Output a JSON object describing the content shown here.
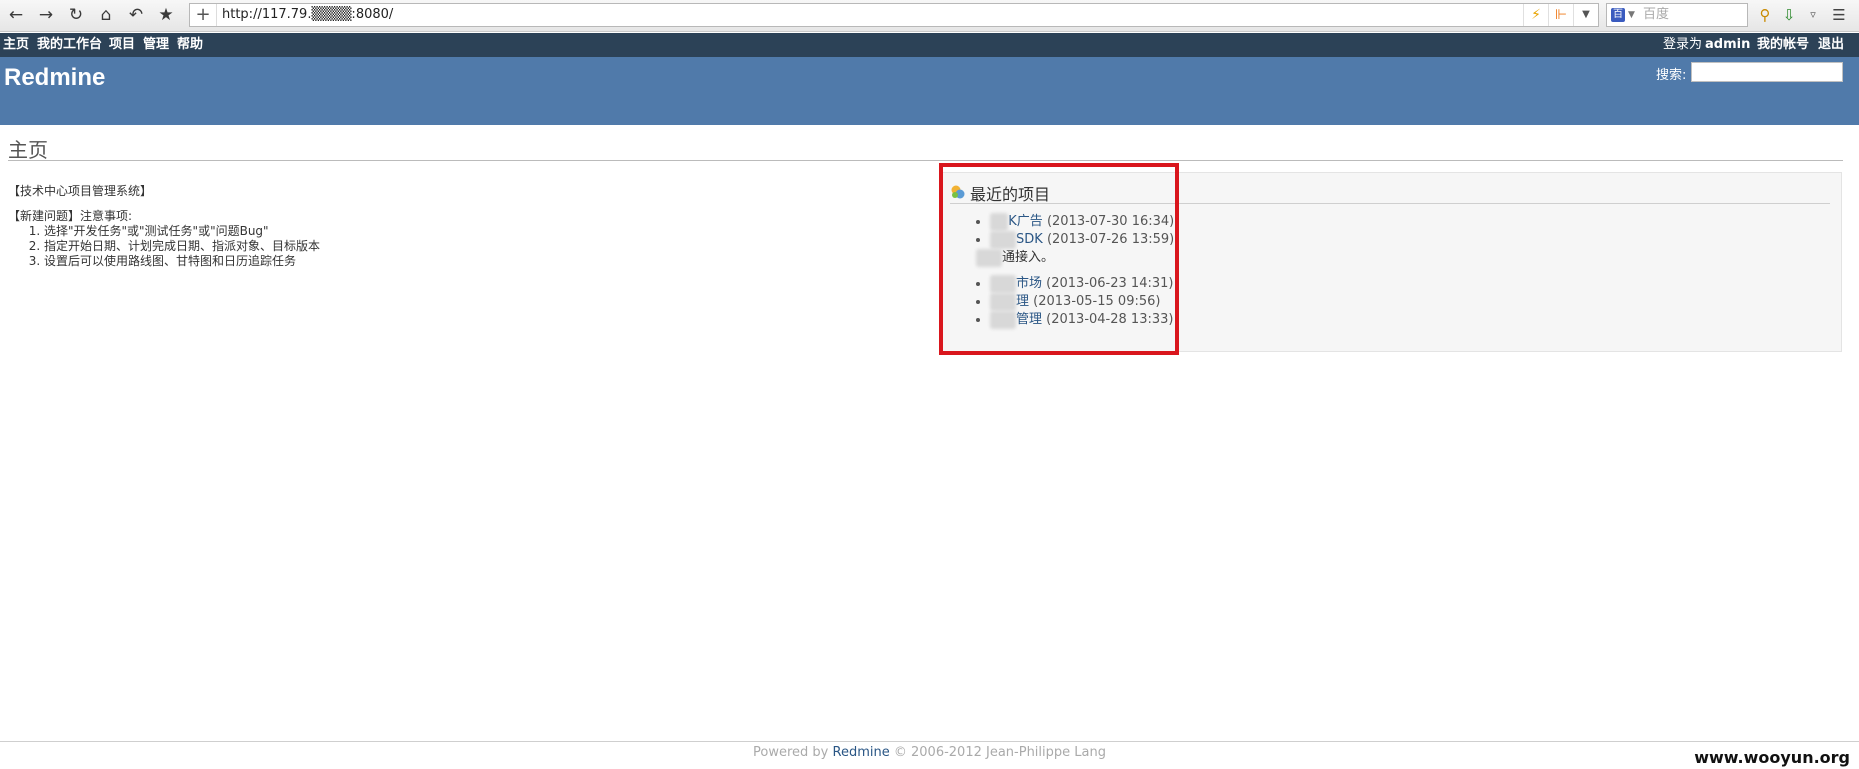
{
  "browser": {
    "url": "http://117.79.▒▒▒▒:8080/",
    "search_placeholder": "百度",
    "engine_logo": "百",
    "icons": {
      "back": "back-icon",
      "forward": "forward-icon",
      "reload": "reload-icon",
      "home": "home-icon",
      "undo": "undo-icon",
      "bookmark": "star-icon",
      "add": "plus-icon",
      "lightning": "lightning-icon",
      "rss": "rss-icon",
      "dropdown": "chevron-down-icon",
      "key": "key-icon",
      "download": "download-icon",
      "menu": "menu-icon"
    }
  },
  "top_menu": {
    "items": [
      "主页",
      "我的工作台",
      "项目",
      "管理",
      "帮助"
    ],
    "logged_in_prefix": "登录为",
    "user": "admin",
    "my_account": "我的帐号",
    "logout": "退出"
  },
  "header": {
    "title": "Redmine",
    "search_label": "搜索:"
  },
  "content": {
    "page_title": "主页",
    "welcome_title": "【技术中心项目管理系统】",
    "notes_title": "【新建问题】注意事项:",
    "notes": [
      "选择\"开发任务\"或\"测试任务\"或\"问题Bug\"",
      "指定开始日期、计划完成日期、指派对象、目标版本",
      "设置后可以使用路线图、甘特图和日历追踪任务"
    ]
  },
  "recent_projects": {
    "title": "最近的项目",
    "icon": "projects-icon",
    "items": [
      {
        "name_hidden": "SD",
        "name": "K广告",
        "date": "(2013-07-30 16:34)",
        "description": ""
      },
      {
        "name_hidden": "支付",
        "name": "SDK",
        "date": "(2013-07-26 13:59)",
        "description_hidden": "支付",
        "description": "通接入。"
      },
      {
        "name_hidden": "移动",
        "name": "市场",
        "date": "(2013-06-23 14:31)",
        "description": ""
      },
      {
        "name_hidden": "项目",
        "name": "理",
        "date": "(2013-05-15 09:56)",
        "description": ""
      },
      {
        "name_hidden": "产品",
        "name": "管理",
        "date": "(2013-04-28 13:33)",
        "description": ""
      }
    ]
  },
  "footer": {
    "prefix": "Powered by",
    "link": "Redmine",
    "suffix": "© 2006-2012 Jean-Philippe Lang"
  },
  "watermark": "www.wooyun.org",
  "colors": {
    "top_menu_bg": "#2c4257",
    "header_bg": "#507aaa",
    "link": "#2a5685",
    "highlight": "#d9161d"
  }
}
